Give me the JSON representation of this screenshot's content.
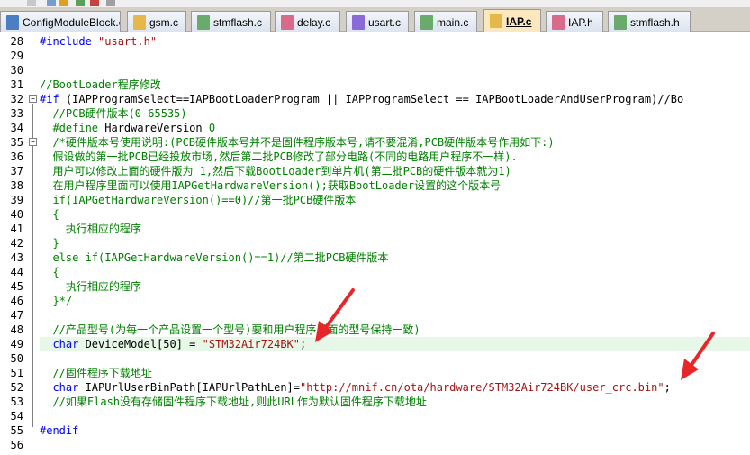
{
  "tabs": [
    {
      "label": "ConfigModuleBlock.c",
      "icon": "c-file-icon"
    },
    {
      "label": "gsm.c",
      "icon": "c-file-icon"
    },
    {
      "label": "stmflash.c",
      "icon": "c-file-icon"
    },
    {
      "label": "delay.c",
      "icon": "c-file-icon"
    },
    {
      "label": "usart.c",
      "icon": "c-file-icon"
    },
    {
      "label": "main.c",
      "icon": "c-file-icon"
    },
    {
      "label": "IAP.c",
      "icon": "c-file-icon",
      "active": true
    },
    {
      "label": "IAP.h",
      "icon": "h-file-icon"
    },
    {
      "label": "stmflash.h",
      "icon": "h-file-icon"
    }
  ],
  "line_numbers": [
    "28",
    "29",
    "30",
    "31",
    "32",
    "33",
    "34",
    "35",
    "36",
    "37",
    "38",
    "39",
    "40",
    "41",
    "42",
    "43",
    "44",
    "45",
    "46",
    "47",
    "48",
    "49",
    "50",
    "51",
    "52",
    "53",
    "54",
    "55",
    "56"
  ],
  "code": {
    "l28_pp": "#include ",
    "l28_str": "\"usart.h\"",
    "l31": "//BootLoader程序修改",
    "l32_pp": "#if",
    "l32_rest": " (IAPProgramSelect==IAPBootLoaderProgram || IAPProgramSelect == IAPBootLoaderAndUserProgram)//Bo",
    "l33": "  //PCB硬件版本(0-65535)",
    "l34_pp": "  #define ",
    "l34_name": "HardwareVersion ",
    "l34_val": "0",
    "l35": "  /*硬件版本号使用说明:(PCB硬件版本号并不是固件程序版本号,请不要混淆,PCB硬件版本号作用如下:)",
    "l36": "  假设做的第一批PCB已经投放市场,然后第二批PCB修改了部分电路(不同的电路用户程序不一样).",
    "l37": "  用户可以修改上面的硬件版为 1,然后下载BootLoader到单片机(第二批PCB的硬件版本就为1)",
    "l38": "  在用户程序里面可以使用IAPGetHardwareVersion();获取BootLoader设置的这个版本号",
    "l39": "  if(IAPGetHardwareVersion()==0)//第一批PCB硬件版本",
    "l40": "  {",
    "l41": "    执行相应的程序",
    "l42": "  }",
    "l43": "  else if(IAPGetHardwareVersion()==1)//第二批PCB硬件版本",
    "l44": "  {",
    "l45": "    执行相应的程序",
    "l46": "  }*/",
    "l48": "  //产品型号(为每一个产品设置一个型号)要和用户程序里面的型号保持一致)",
    "l49_kw": "  char ",
    "l49_rest": "DeviceModel[50] = ",
    "l49_str": "\"STM32Air724BK\"",
    "l49_end": ";",
    "l51": "  //固件程序下载地址",
    "l52_kw": "  char ",
    "l52_rest": "IAPUrlUserBinPath[IAPUrlPathLen]=",
    "l52_str": "\"http://mnif.cn/ota/hardware/STM32Air724BK/user_crc.bin\"",
    "l52_end": ";",
    "l53": "  //如果Flash没有存储固件程序下载地址,则此URL作为默认固件程序下载地址",
    "l55": "#endif"
  },
  "colors": {
    "comment": "#008000",
    "keyword": "#0000ff",
    "string": "#a31515",
    "highlight_line": "#e8f8e8",
    "arrow": "#e8262a",
    "active_tab": "#fbe8bf"
  }
}
